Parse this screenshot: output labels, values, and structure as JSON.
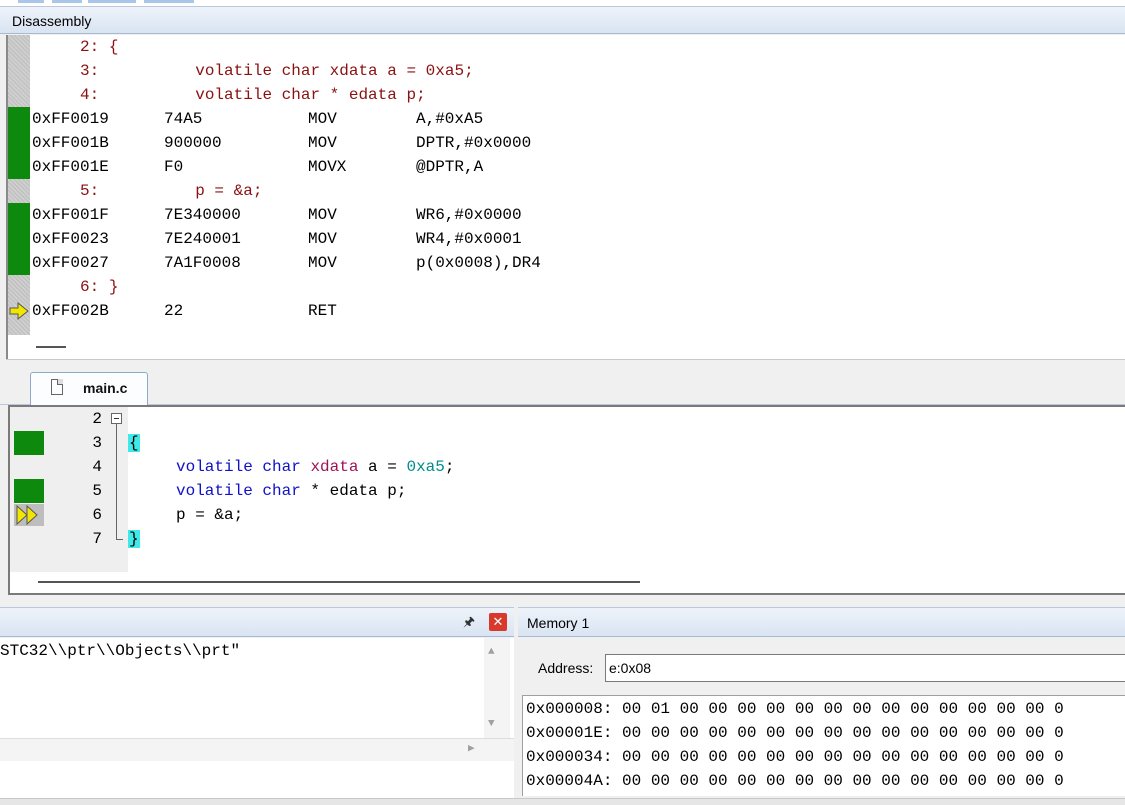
{
  "disassembly": {
    "title": "Disassembly",
    "lines": [
      {
        "kind": "src",
        "text": "     2: {",
        "mark": "none"
      },
      {
        "kind": "src",
        "text": "     3:          volatile char xdata a = 0xa5;",
        "mark": "none"
      },
      {
        "kind": "src",
        "text": "     4:          volatile char * edata p;",
        "mark": "none"
      },
      {
        "kind": "asm",
        "addr": "0xFF0019",
        "op": "74A5",
        "mn": "MOV",
        "arg": "A,#0xA5",
        "mark": "green"
      },
      {
        "kind": "asm",
        "addr": "0xFF001B",
        "op": "900000",
        "mn": "MOV",
        "arg": "DPTR,#0x0000",
        "mark": "green"
      },
      {
        "kind": "asm",
        "addr": "0xFF001E",
        "op": "F0",
        "mn": "MOVX",
        "arg": "@DPTR,A",
        "mark": "green"
      },
      {
        "kind": "src",
        "text": "     5:          p = &a;",
        "mark": "none"
      },
      {
        "kind": "asm",
        "addr": "0xFF001F",
        "op": "7E340000",
        "mn": "MOV",
        "arg": "WR6,#0x0000",
        "mark": "green"
      },
      {
        "kind": "asm",
        "addr": "0xFF0023",
        "op": "7E240001",
        "mn": "MOV",
        "arg": "WR4,#0x0001",
        "mark": "green"
      },
      {
        "kind": "asm",
        "addr": "0xFF0027",
        "op": "7A1F0008",
        "mn": "MOV",
        "arg": "p(0x0008),DR4",
        "mark": "green"
      },
      {
        "kind": "src",
        "text": "     6: }",
        "mark": "none"
      },
      {
        "kind": "asm",
        "addr": "0xFF002B",
        "op": "22",
        "mn": "RET",
        "arg": "",
        "mark": "arrow"
      }
    ]
  },
  "editor": {
    "tab_label": "main.c",
    "lines": [
      {
        "num": "2",
        "mark": "none"
      },
      {
        "num": "3",
        "mark": "green"
      },
      {
        "num": "4",
        "mark": "none"
      },
      {
        "num": "5",
        "mark": "green"
      },
      {
        "num": "6",
        "mark": "arrow"
      },
      {
        "num": "7",
        "mark": "none"
      }
    ],
    "code": {
      "l2_brace": "{",
      "l3_kw1": "volatile",
      "l3_kw2": "char",
      "l3_kw3": "xdata",
      "l3_rest": " a = ",
      "l3_num": "0xa5",
      "l3_end": ";",
      "l4_kw1": "volatile",
      "l4_kw2": "char",
      "l4_rest": " * edata p;",
      "l5_text": "p = &a;",
      "l6_brace": "}"
    }
  },
  "output_panel": {
    "text": "STC32\\\\ptr\\\\Objects\\\\prt\""
  },
  "memory": {
    "title": "Memory 1",
    "address_label": "Address:",
    "address_value": "e:0x08",
    "rows": [
      "0x000008: 00 01 00 00 00 00 00 00 00 00 00 00 00 00 00 0",
      "0x00001E: 00 00 00 00 00 00 00 00 00 00 00 00 00 00 00 0",
      "0x000034: 00 00 00 00 00 00 00 00 00 00 00 00 00 00 00 0",
      "0x00004A: 00 00 00 00 00 00 00 00 00 00 00 00 00 00 00 0"
    ]
  },
  "colors": {
    "breakpoint_green": "#0d8a0d",
    "source_line": "#8b1010",
    "keyword": "#1010c8",
    "brace_highlight": "#40e8e8",
    "arrow_yellow": "#f2e600"
  }
}
